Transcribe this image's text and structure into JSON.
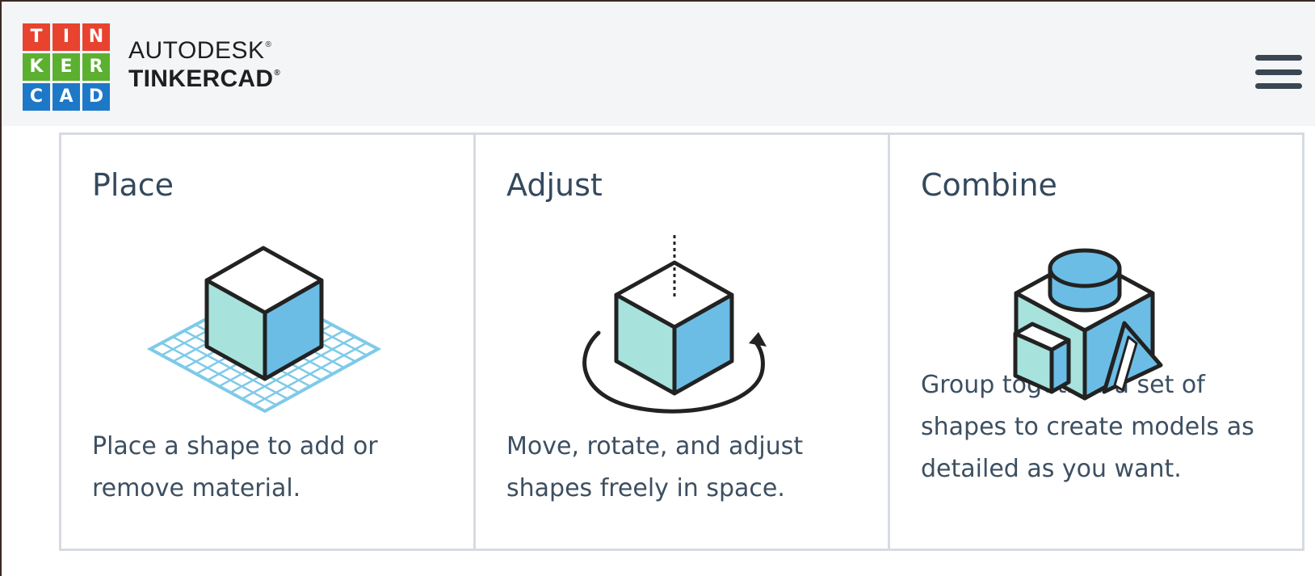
{
  "header": {
    "logo_letters": [
      "T",
      "I",
      "N",
      "K",
      "E",
      "R",
      "C",
      "A",
      "D"
    ],
    "logo_colors": [
      "#e7432f",
      "#e7432f",
      "#e7432f",
      "#5bb030",
      "#5bb030",
      "#5bb030",
      "#1d78c8",
      "#1d78c8",
      "#1d78c8"
    ],
    "brand_top": "AUTODESK",
    "brand_bottom": "TINKERCAD",
    "registered_mark": "®",
    "menu_icon": "hamburger-menu-icon"
  },
  "cards": [
    {
      "title": "Place",
      "description": "Place a shape to add or remove material.",
      "illustration": "cube-on-grid-icon"
    },
    {
      "title": "Adjust",
      "description": "Move, rotate, and adjust shapes freely in space.",
      "illustration": "rotating-cube-icon"
    },
    {
      "title": "Combine",
      "description": "Group together a set of shapes to create models as detailed as you want.",
      "illustration": "combined-shapes-icon"
    }
  ],
  "colors": {
    "cube_left": "#a8e2dc",
    "cube_right": "#6bbde6",
    "cube_top": "#ffffff",
    "grid": "#7ecae8",
    "outline": "#222222",
    "card_border": "#d6dbe1",
    "header_bg": "#f4f5f6"
  }
}
